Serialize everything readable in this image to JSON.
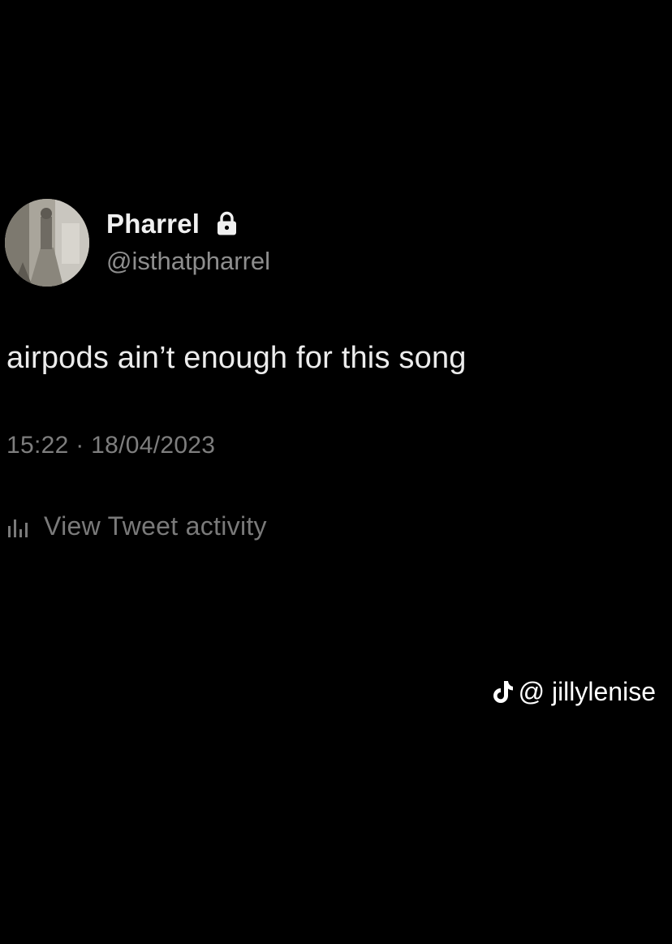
{
  "tweet": {
    "display_name": "Pharrel",
    "handle": "@isthatpharrel",
    "protected_icon": "lock-icon",
    "text": "airpods ain’t enough for this song",
    "timestamp": "15:22 · 18/04/2023",
    "activity_icon": "bar-chart-icon",
    "activity_label": "View Tweet activity"
  },
  "watermark": {
    "icon": "tiktok-icon",
    "username": "@ jillylenise"
  },
  "colors": {
    "background": "#000000",
    "primary_text": "#ececec",
    "secondary_text": "#7e7e7e",
    "watermark_text": "#ffffff"
  }
}
